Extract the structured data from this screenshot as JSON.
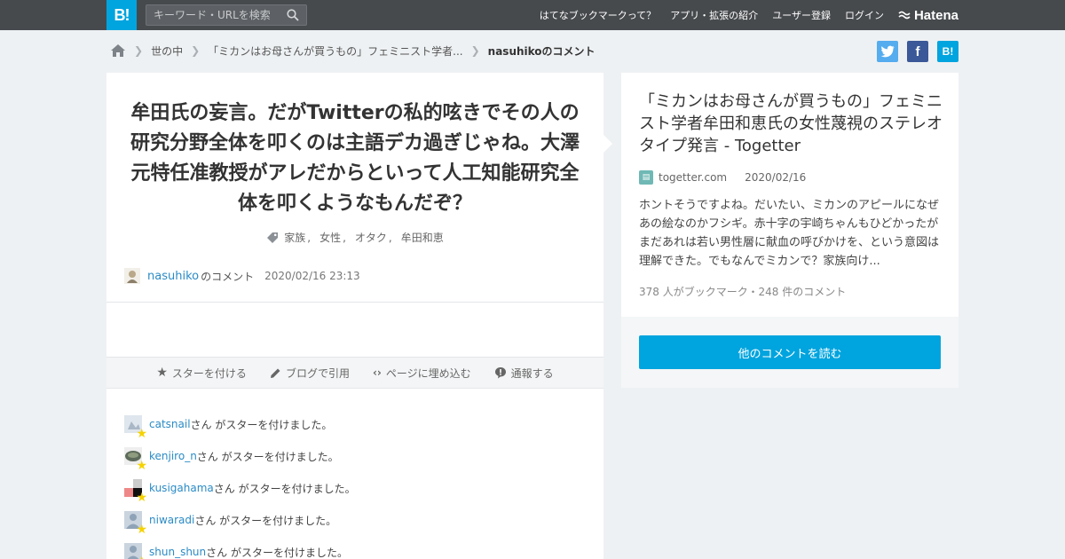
{
  "header": {
    "logo_text": "B!",
    "search_placeholder": "キーワード・URLを検索",
    "nav": {
      "about": "はてなブックマークって？",
      "apps": "アプリ・拡張の紹介",
      "register": "ユーザー登録",
      "login": "ログイン",
      "brand": "Hatena"
    }
  },
  "breadcrumb": {
    "category": "世の中",
    "entry": "「ミカンはお母さんが買うもの」フェミニスト学者...",
    "current": "nasuhikoのコメント"
  },
  "share": {
    "twitter_color": "#55acee",
    "facebook_color": "#3b5998",
    "hatena_color": "#00a4de",
    "facebook_label": "f",
    "hatena_label": "B!"
  },
  "comment": {
    "text": "牟田氏の妄言。だがTwitterの私的呟きでその人の研究分野全体を叩くのは主語デカ過ぎじゃね。大澤元特任准教授がアレだからといって人工知能研究全体を叩くようなもんだぞ？",
    "tags": [
      "家族",
      "女性",
      "オタク",
      "牟田和恵"
    ],
    "user": "nasuhiko",
    "suffix": "のコメント",
    "datetime": "2020/02/16 23:13"
  },
  "actions": {
    "star": "スターを付ける",
    "blog": "ブログで引用",
    "embed": "ページに埋め込む",
    "report": "通報する"
  },
  "stars": [
    {
      "user": "catsnail",
      "text": "さん がスターを付けました。"
    },
    {
      "user": "kenjiro_n",
      "text": "さん がスターを付けました。"
    },
    {
      "user": "kusigahama",
      "text": "さん がスターを付けました。"
    },
    {
      "user": "niwaradi",
      "text": "さん がスターを付けました。"
    },
    {
      "user": "shun_shun",
      "text": "さん がスターを付けました。"
    }
  ],
  "entry": {
    "title": "「ミカンはお母さんが買うもの」フェミニスト学者牟田和恵氏の女性蔑視のステレオタイプ発言 - Togetter",
    "domain": "togetter.com",
    "date": "2020/02/16",
    "excerpt": "ホントそうですよね。だいたい、ミカンのアピールになぜあの絵なのかフシギ。赤十字の宇崎ちゃんもひどかったがまだあれは若い男性層に献血の呼びかけを、という意図は理解できた。でもなんでミカンで？家族向け...",
    "counts": "378 人がブックマーク・248 件のコメント",
    "read_more": "他のコメントを読む"
  }
}
